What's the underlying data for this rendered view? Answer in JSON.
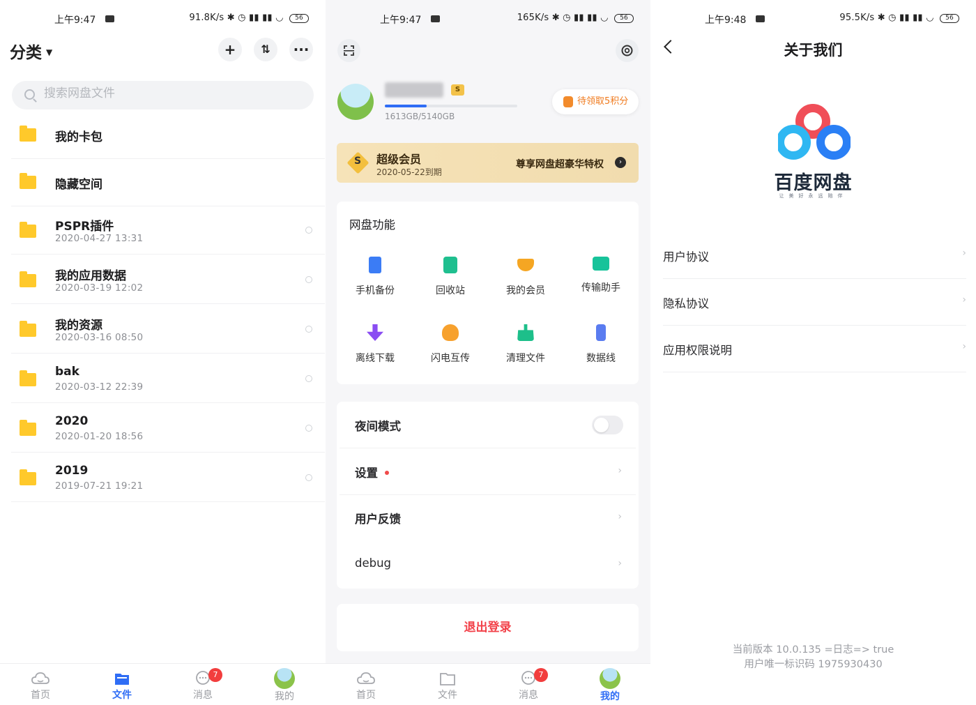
{
  "status_bars": [
    {
      "time": "上午9:47",
      "network": "91.8K/s",
      "battery": "56"
    },
    {
      "time": "上午9:47",
      "network": "165K/s",
      "battery": "56"
    },
    {
      "time": "上午9:48",
      "network": "95.5K/s",
      "battery": "56"
    }
  ],
  "files_screen": {
    "title": "分类",
    "search_placeholder": "搜索网盘文件",
    "folders": [
      {
        "name": "我的卡包",
        "date": ""
      },
      {
        "name": "隐藏空间",
        "date": ""
      },
      {
        "name": "PSPR插件",
        "date": "2020-04-27  13:31"
      },
      {
        "name": "我的应用数据",
        "date": "2020-03-19  12:02"
      },
      {
        "name": "我的资源",
        "date": "2020-03-16  08:50"
      },
      {
        "name": "bak",
        "date": "2020-03-12  22:39"
      },
      {
        "name": "2020",
        "date": "2020-01-20  18:56"
      },
      {
        "name": "2019",
        "date": "2019-07-21  19:21"
      }
    ]
  },
  "profile_screen": {
    "quota_text": "1613GB/5140GB",
    "quota_fraction": 0.314,
    "points_button": "待领取5积分",
    "vip": {
      "title": "超级会员",
      "expiry": "2020-05-22到期",
      "cta": "尊享网盘超豪华特权",
      "coin": "S"
    },
    "features_title": "网盘功能",
    "features": [
      {
        "label": "手机备份",
        "color": "#3b7cf5"
      },
      {
        "label": "回收站",
        "color": "#1fbf8f"
      },
      {
        "label": "我的会员",
        "color": "#f5a623"
      },
      {
        "label": "传输助手",
        "color": "#17c39a"
      },
      {
        "label": "离线下载",
        "color": "#8a4df2"
      },
      {
        "label": "闪电互传",
        "color": "#f7a12d"
      },
      {
        "label": "清理文件",
        "color": "#1dbf8a"
      },
      {
        "label": "数据线",
        "color": "#5a7cf0"
      }
    ],
    "settings": [
      {
        "label": "夜间模式"
      },
      {
        "label": "设置"
      },
      {
        "label": "用户反馈"
      },
      {
        "label": "debug"
      }
    ],
    "logout": "退出登录"
  },
  "about_screen": {
    "title": "关于我们",
    "brand": "百度网盘",
    "tagline": "让美好永远陪伴",
    "items": [
      {
        "label": "用户协议"
      },
      {
        "label": "隐私协议"
      },
      {
        "label": "应用权限说明"
      }
    ],
    "version_line": "当前版本  10.0.135 =日志=> true",
    "uid_line": "用户唯一标识码 1975930430"
  },
  "bottom_nav": {
    "items": [
      {
        "label": "首页"
      },
      {
        "label": "文件"
      },
      {
        "label": "消息"
      },
      {
        "label": "我的"
      }
    ],
    "message_badge": "7"
  },
  "colors": {
    "accent": "#2f6df5",
    "danger": "#f2424a",
    "folder": "#ffc92b",
    "vip_gold": "#f3bf3d"
  }
}
